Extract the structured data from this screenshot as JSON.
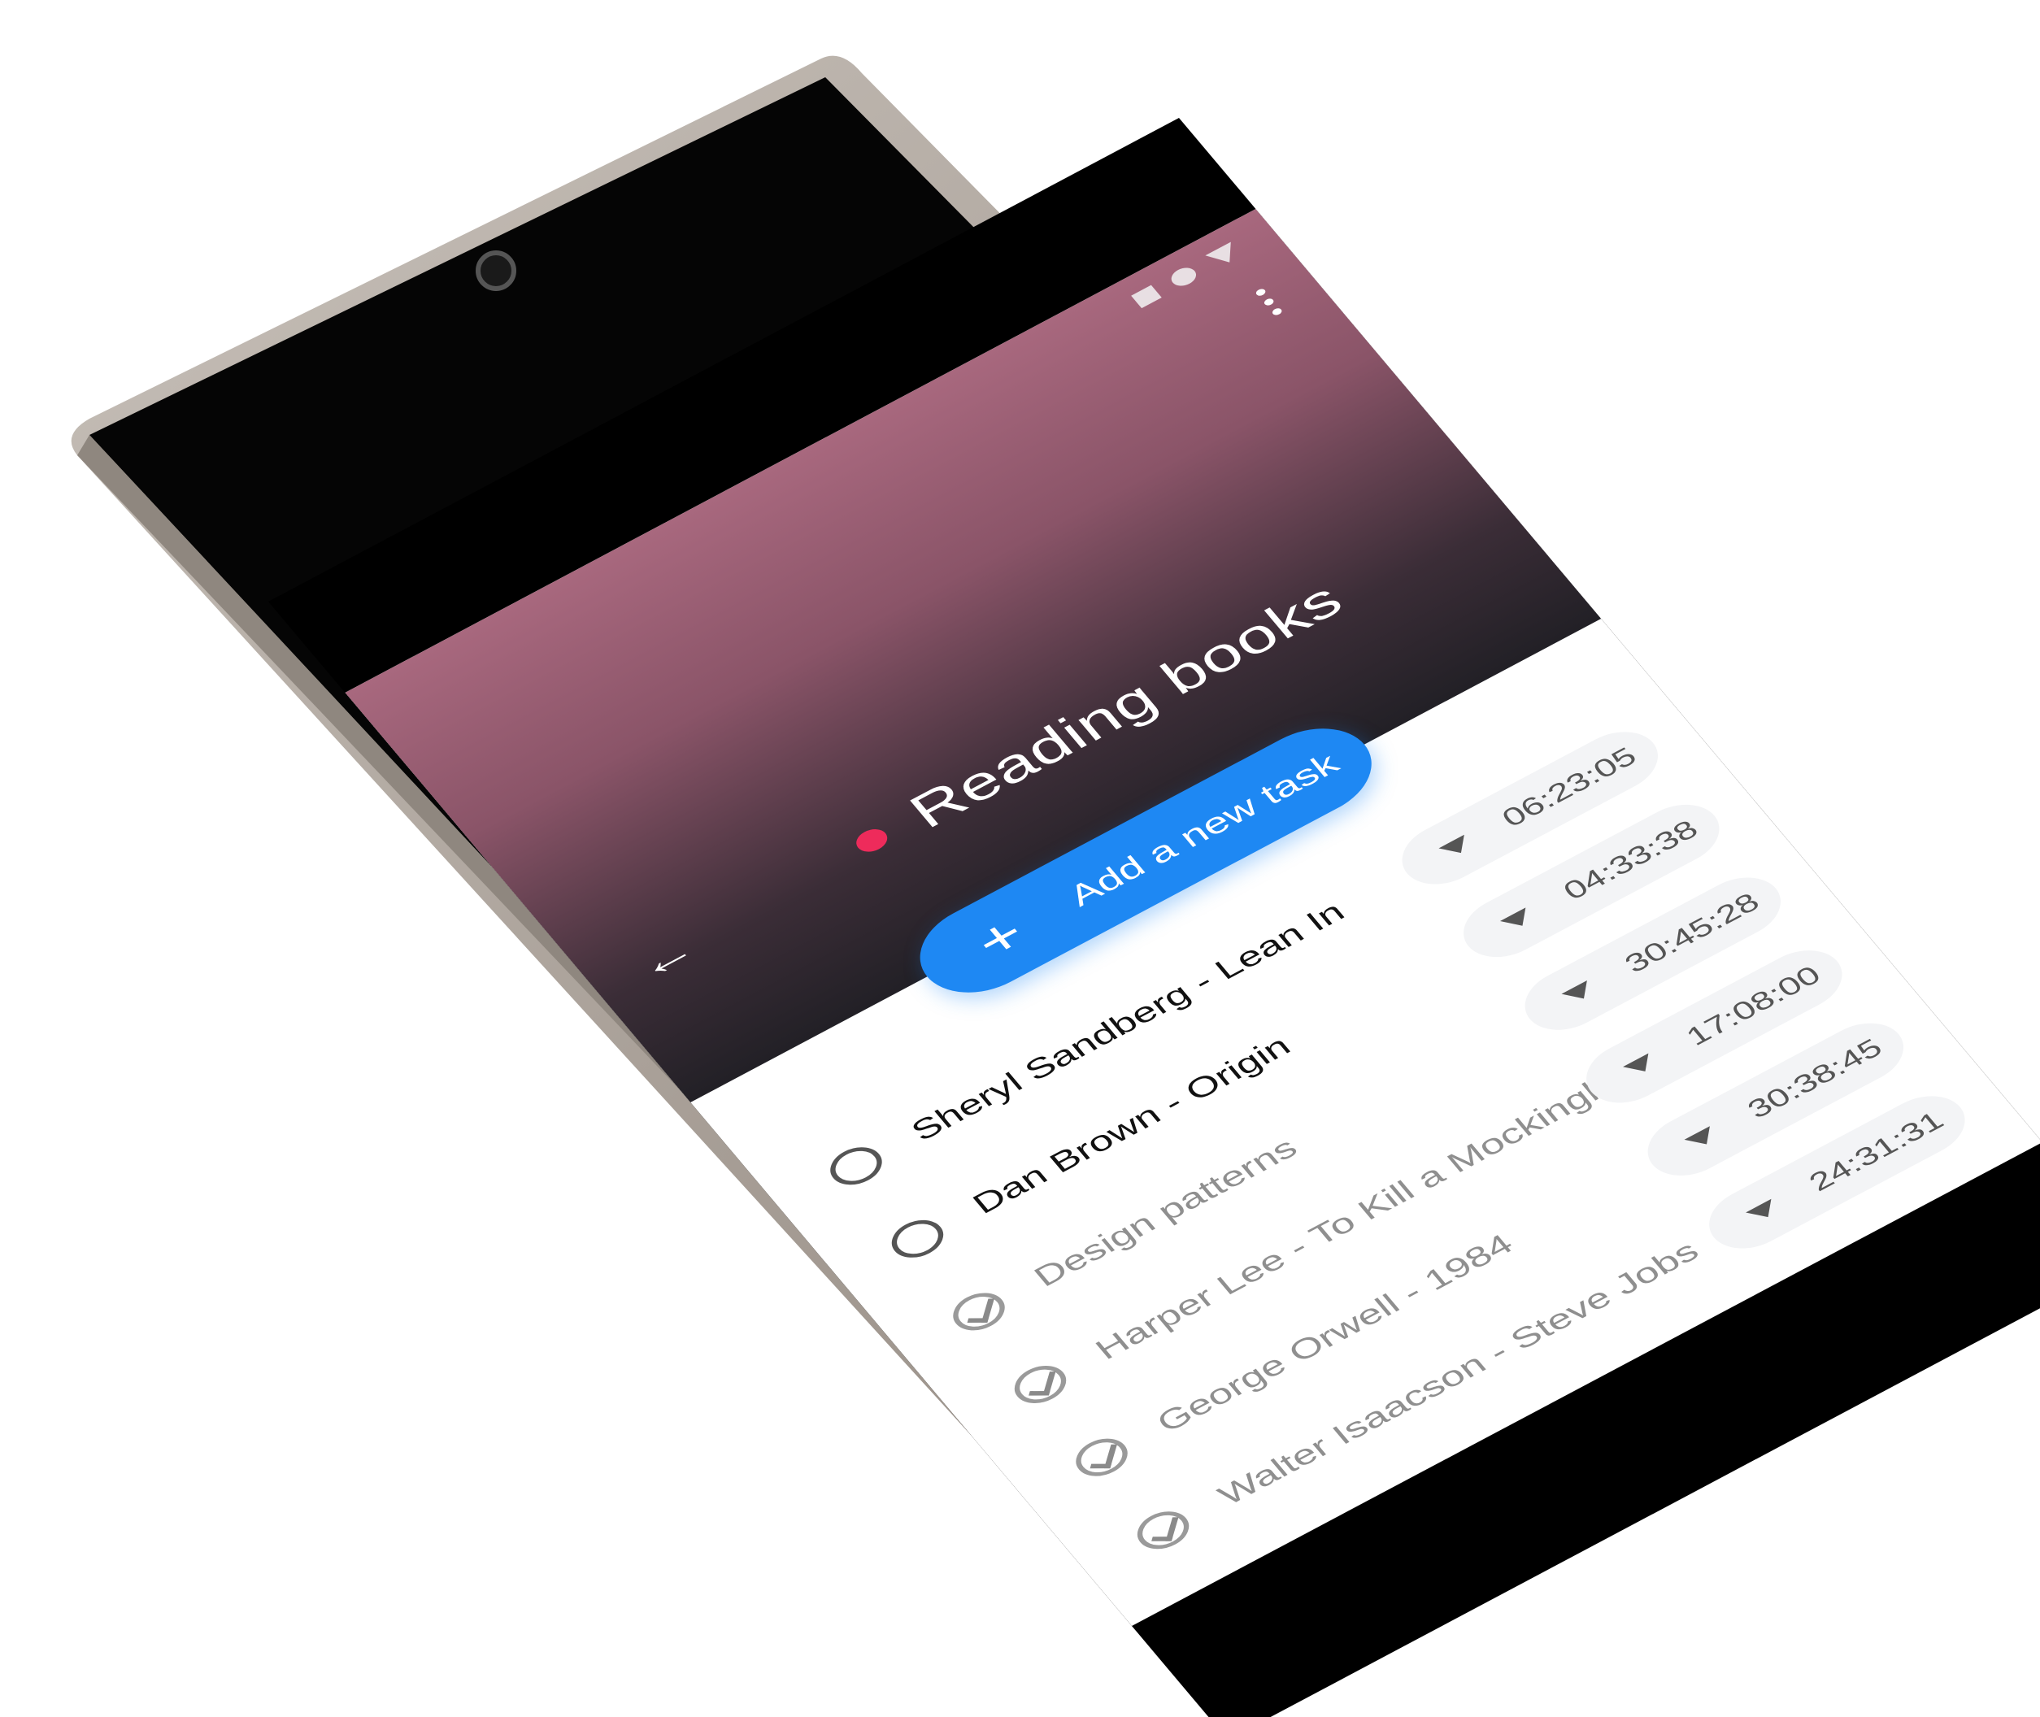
{
  "status_bar": {
    "icons": [
      "square-icon",
      "circle-icon",
      "signal-triangle-icon"
    ]
  },
  "header": {
    "back_icon": "arrow-left-icon",
    "menu_icon": "more-vertical-icon",
    "title": "Reading books",
    "title_dot_color": "#ee2b5b"
  },
  "add_task": {
    "label": "Add a new task",
    "icon": "plus-icon",
    "color": "#1e88f3"
  },
  "tasks": [
    {
      "label": "Sheryl Sandberg - Lean In",
      "done": false,
      "timer": "06:23:05"
    },
    {
      "label": "Dan Brown - Origin",
      "done": false,
      "timer": "04:33:38"
    },
    {
      "label": "Design patterns",
      "done": true,
      "timer": "30:45:28"
    },
    {
      "label": "Harper Lee - To Kill a Mockingbird",
      "done": true,
      "timer": "17:08:00"
    },
    {
      "label": "George Orwell - 1984",
      "done": true,
      "timer": "30:38:45"
    },
    {
      "label": "Walter Isaacson - Steve Jobs",
      "done": true,
      "timer": "24:31:31"
    }
  ]
}
